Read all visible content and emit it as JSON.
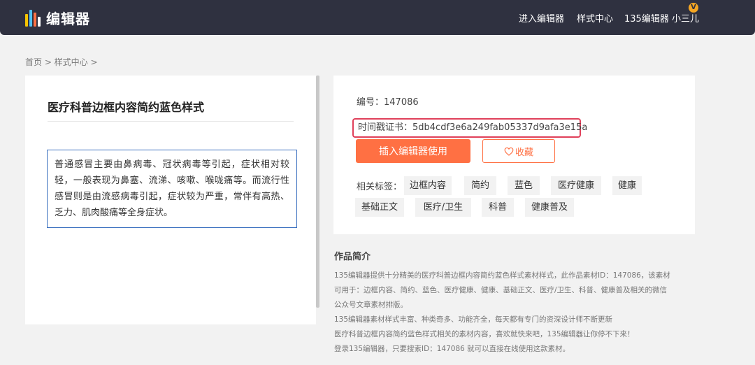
{
  "header": {
    "logo_text": "编辑器",
    "nav": [
      "进入编辑器",
      "样式中心"
    ],
    "user_name": "135编辑器 小三儿",
    "vip_badge": "V"
  },
  "breadcrumb": "首页 > 样式中心 >",
  "style": {
    "title": "医疗科普边框内容简约蓝色样式",
    "preview_text": "普通感冒主要由鼻病毒、冠状病毒等引起，症状相对较轻，一般表现为鼻塞、流涕、咳嗽、喉咙痛等。而流行性感冒则是由流感病毒引起，症状较为严重，常伴有高热、乏力、肌肉酸痛等全身症状。"
  },
  "info": {
    "code_line": "编号：147086",
    "hash_line": "时间戳证书：5db4cdf3e6a249fab05337d9afa3e15a",
    "insert_button": "插入编辑器使用",
    "fav_button": "收藏",
    "tags_label": "相关标签：",
    "tags": [
      "边框内容",
      "简约",
      "蓝色",
      "医疗健康",
      "健康",
      "基础正文",
      "医疗/卫生",
      "科普",
      "健康普及"
    ]
  },
  "intro": {
    "title": "作品简介",
    "lines": [
      "135编辑器提供十分精美的医疗科普边框内容简约蓝色样式素材样式，此作品素材ID：147086，该素材",
      "可用于：边框内容、简约、蓝色、医疗健康、健康、基础正文、医疗/卫生、科普、健康普及相关的微信",
      "公众号文章素材排版。",
      "135编辑器素材样式丰富、种类奇多、功能齐全，每天都有专门的资深设计师不断更新",
      "医疗科普边框内容简约蓝色样式相关的素材内容，喜欢就快来吧，135编辑器让你停不下来！",
      "登录135编辑器，只要搜索ID：147086 就可以直接在线使用这款素材。"
    ]
  },
  "colors": {
    "topbar": "#2f3140",
    "accent": "#ff7043",
    "highlight_border": "#e0405a",
    "preview_border": "#3a6fbf"
  }
}
